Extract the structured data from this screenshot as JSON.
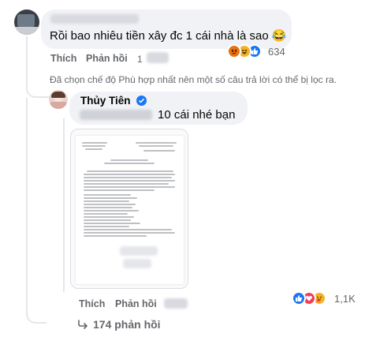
{
  "comment1": {
    "text": "Rồi bao nhiêu tiền xây đc 1 cái nhà là sao 😂",
    "like_label": "Thích",
    "reply_label": "Phản hồi",
    "time_label": "1",
    "reaction_count": "634",
    "reactions": [
      "angry-icon",
      "haha-icon",
      "like-icon"
    ]
  },
  "notice": "Đã chọn chế độ Phù hợp nhất nên một số câu trả lời có thể bị lọc ra.",
  "reply": {
    "author": "Thủy Tiên",
    "verified_icon": "verified-badge-icon",
    "text": "10 cái nhé bạn",
    "like_label": "Thích",
    "reply_label": "Phản hồi",
    "reaction_count": "1,1K",
    "reactions": [
      "like-icon",
      "love-icon",
      "care-icon"
    ],
    "attachment": "document-image"
  },
  "more_replies": {
    "icon": "reply-arrow-icon",
    "label": "174 phản hồi"
  },
  "colors": {
    "like_blue": "#1877f2",
    "love_red": "#f33e58",
    "angry_orange": "#e9710f",
    "haha_yellow": "#f7b125",
    "secondary_text": "#65676b",
    "bubble_bg": "#f0f2f5"
  }
}
